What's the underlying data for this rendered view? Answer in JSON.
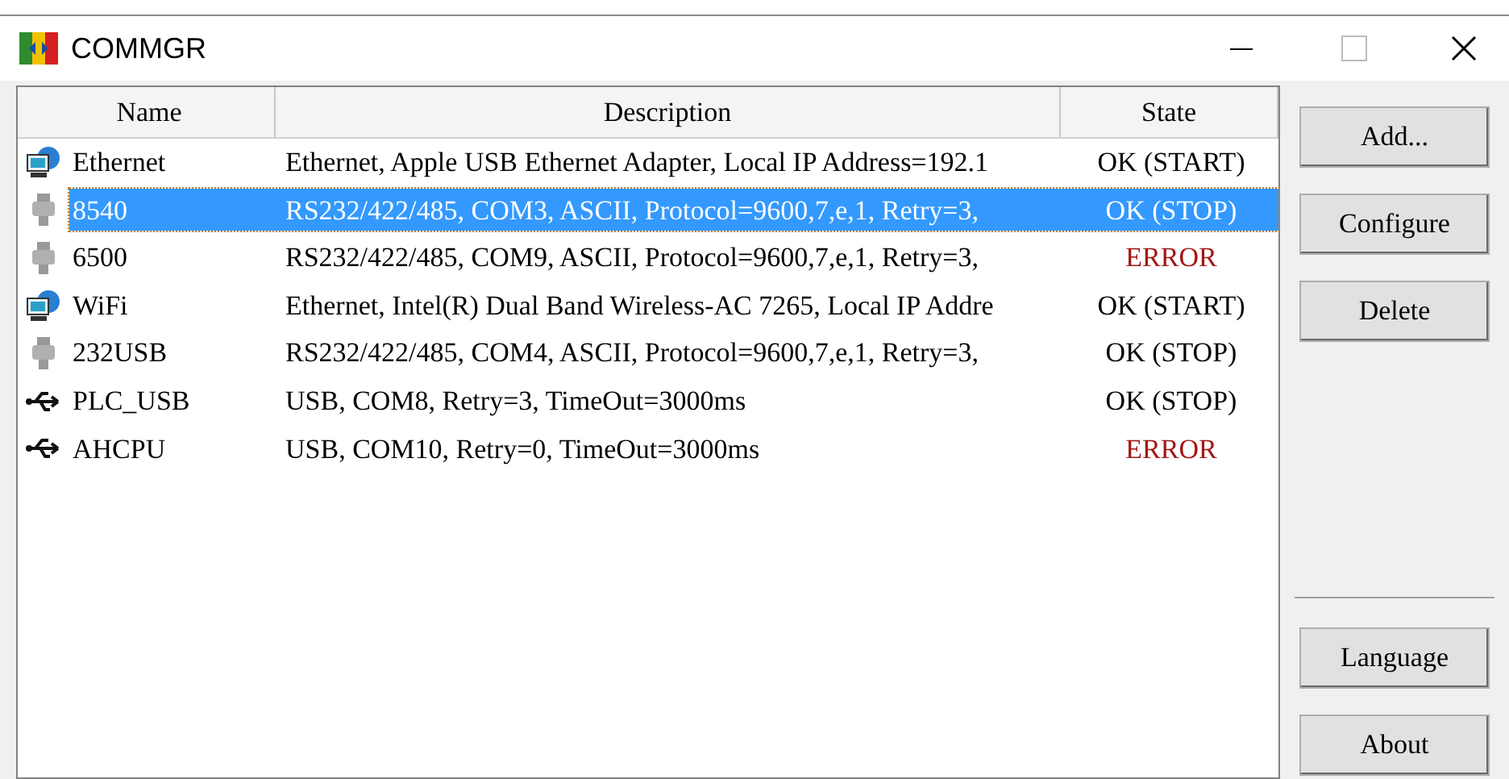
{
  "window": {
    "title": "COMMGR"
  },
  "table": {
    "columns": [
      "Name",
      "Description",
      "State"
    ],
    "rows": [
      {
        "kind": "ethernet",
        "name": "Ethernet",
        "description": "Ethernet, Apple USB Ethernet Adapter, Local IP Address=192.1",
        "state": "OK (START)",
        "error": false,
        "selected": false
      },
      {
        "kind": "serial",
        "name": "8540",
        "description": "RS232/422/485, COM3, ASCII, Protocol=9600,7,e,1, Retry=3,",
        "state": "OK (STOP)",
        "error": false,
        "selected": true
      },
      {
        "kind": "serial",
        "name": "6500",
        "description": "RS232/422/485, COM9, ASCII, Protocol=9600,7,e,1, Retry=3,",
        "state": "ERROR",
        "error": true,
        "selected": false
      },
      {
        "kind": "ethernet",
        "name": "WiFi",
        "description": "Ethernet, Intel(R) Dual Band Wireless-AC 7265, Local IP Addre",
        "state": "OK (START)",
        "error": false,
        "selected": false
      },
      {
        "kind": "serial",
        "name": "232USB",
        "description": "RS232/422/485, COM4, ASCII, Protocol=9600,7,e,1, Retry=3,",
        "state": "OK (STOP)",
        "error": false,
        "selected": false
      },
      {
        "kind": "usb",
        "name": "PLC_USB",
        "description": "USB, COM8, Retry=3, TimeOut=3000ms",
        "state": "OK (STOP)",
        "error": false,
        "selected": false
      },
      {
        "kind": "usb",
        "name": "AHCPU",
        "description": "USB, COM10, Retry=0, TimeOut=3000ms",
        "state": "ERROR",
        "error": true,
        "selected": false
      }
    ]
  },
  "buttons_top": [
    "Add...",
    "Configure",
    "Delete"
  ],
  "buttons_bottom": [
    "Language",
    "About"
  ]
}
